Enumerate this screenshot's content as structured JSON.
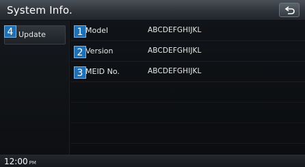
{
  "header": {
    "title": "System Info."
  },
  "sidebar": {
    "update_label": "Update"
  },
  "callouts": [
    "1",
    "2",
    "3",
    "4"
  ],
  "info_rows": [
    {
      "label": "Model",
      "value": "ABCDEFGHIJKL"
    },
    {
      "label": "Version",
      "value": "ABCDEFGHIJKL"
    },
    {
      "label": "MEID No.",
      "value": "ABCDEFGHIJKL"
    }
  ],
  "footer": {
    "time": "12:00",
    "ampm": "PM"
  },
  "icons": {
    "back": "back-arrow-icon"
  },
  "colors": {
    "callout": "#1f6fb4",
    "header": "#2d3238",
    "background": "#0b0d10"
  }
}
